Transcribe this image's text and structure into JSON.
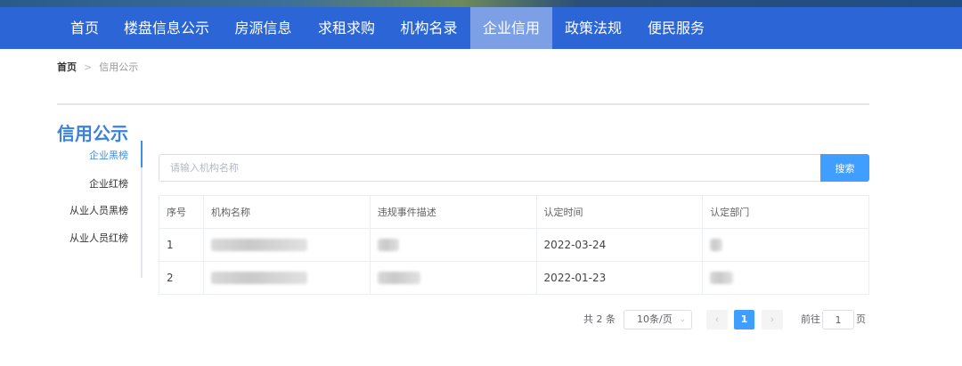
{
  "nav": {
    "items": [
      {
        "label": "首页"
      },
      {
        "label": "楼盘信息公示"
      },
      {
        "label": "房源信息"
      },
      {
        "label": "求租求购"
      },
      {
        "label": "机构名录"
      },
      {
        "label": "企业信用",
        "active": true
      },
      {
        "label": "政策法规"
      },
      {
        "label": "便民服务"
      }
    ]
  },
  "breadcrumb": {
    "home": "首页",
    "separator": ">",
    "current": "信用公示"
  },
  "section": {
    "title": "信用公示"
  },
  "sidebar": {
    "items": [
      {
        "label": "企业黑榜",
        "active": true
      },
      {
        "label": "企业红榜"
      },
      {
        "label": "从业人员黑榜"
      },
      {
        "label": "从业人员红榜"
      }
    ]
  },
  "search": {
    "placeholder": "请输入机构名称",
    "value": "",
    "button_label": "搜索"
  },
  "table": {
    "headers": [
      "序号",
      "机构名称",
      "违规事件描述",
      "认定时间",
      "认定部门"
    ],
    "rows": [
      {
        "index": "1",
        "org_name": "[redacted]",
        "description": "[redacted]",
        "date": "2022-03-24",
        "department": "[redacted]"
      },
      {
        "index": "2",
        "org_name": "[redacted]",
        "description": "[redacted]",
        "date": "2022-01-23",
        "department": "[redacted]"
      }
    ]
  },
  "pagination": {
    "total_text": "共 2 条",
    "page_size": "10条/页",
    "prev_icon": "chevron-left-icon",
    "next_icon": "chevron-right-icon",
    "current_page": "1",
    "goto_label": "前往",
    "goto_value": "1",
    "page_suffix": "页"
  },
  "colors": {
    "nav_bg": "#2c66d6",
    "nav_active": "#7d9fe6",
    "accent": "#409eff",
    "title": "#3b82e0"
  }
}
